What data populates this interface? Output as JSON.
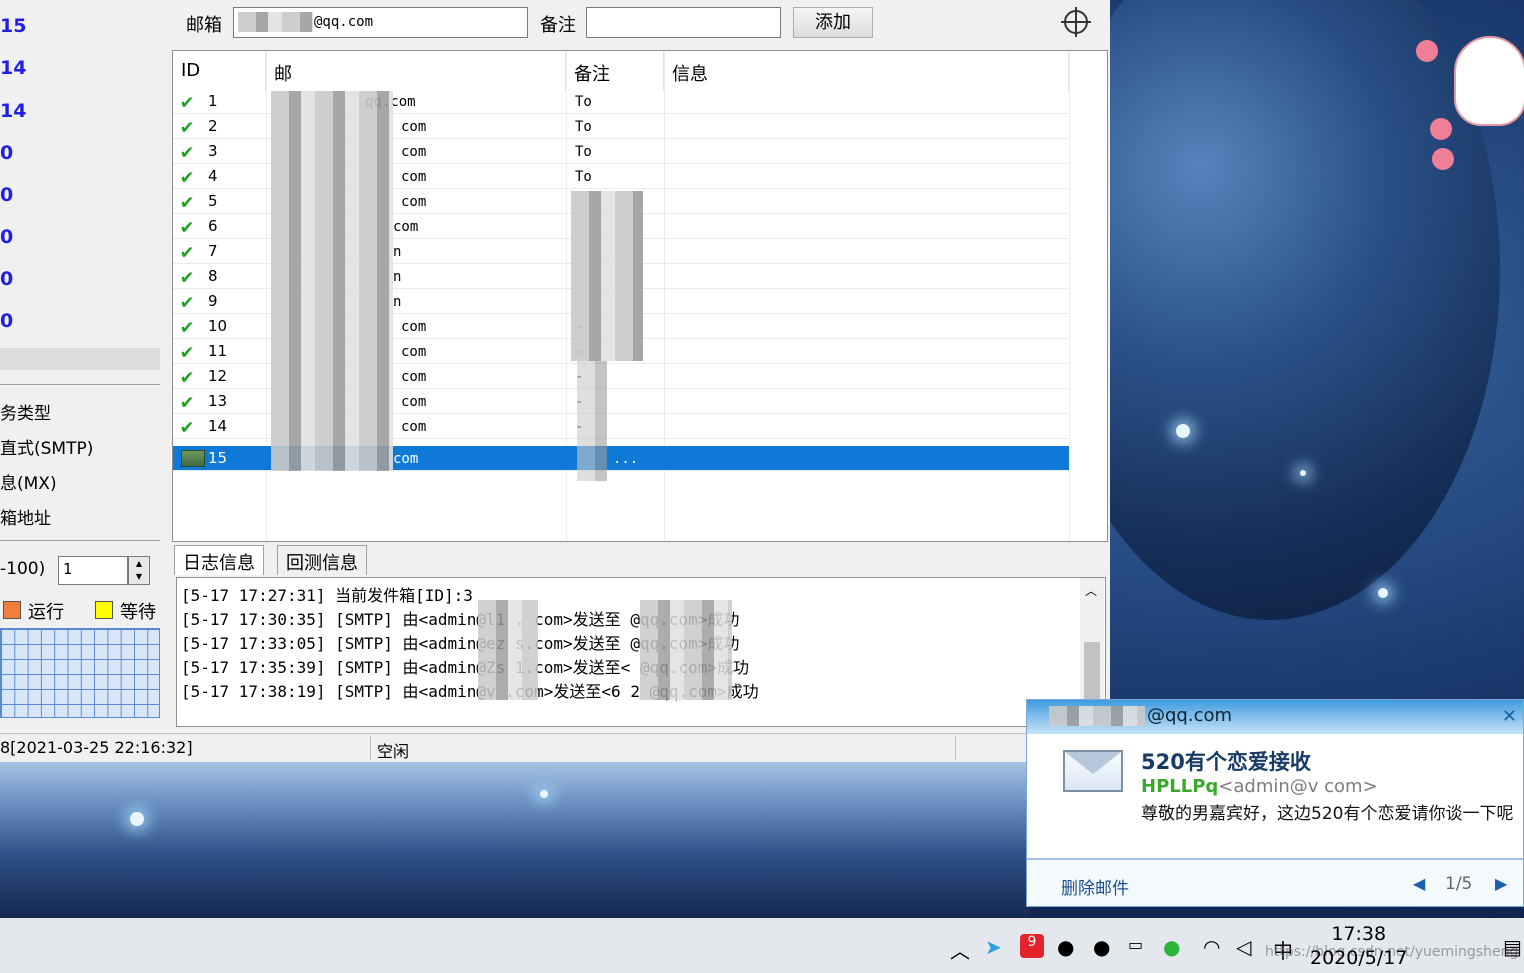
{
  "left_panel": {
    "stats": [
      "15",
      "14",
      "14",
      "0",
      "0",
      "0",
      "0",
      "0"
    ],
    "task_types": [
      "务类型",
      "直式(SMTP)",
      "息(MX)",
      "箱地址"
    ],
    "range_label": "-100)",
    "thread_value": "1",
    "legend": [
      {
        "label": "运行",
        "color": "#f07f3c"
      },
      {
        "label": "等待",
        "color": "#ffff00"
      }
    ]
  },
  "toolbar": {
    "email_label": "邮箱",
    "email_value": "@qq.com",
    "note_label": "备注",
    "note_value": "",
    "add_button": "添加"
  },
  "table": {
    "headers": [
      "ID",
      "邮",
      "备注",
      "信息"
    ],
    "rows": [
      {
        "id": "1",
        "email": "qq.com",
        "note": "To"
      },
      {
        "id": "2",
        "email": "com",
        "note": "To"
      },
      {
        "id": "3",
        "email": "com",
        "note": "To"
      },
      {
        "id": "4",
        "email": "com",
        "note": "To"
      },
      {
        "id": "5",
        "email": "com",
        "note": ""
      },
      {
        "id": "6",
        "email": "com",
        "note": ""
      },
      {
        "id": "7",
        "email": "n",
        "note": ""
      },
      {
        "id": "8",
        "email": "n",
        "note": ""
      },
      {
        "id": "9",
        "email": "n",
        "note": ""
      },
      {
        "id": "10",
        "email": "com",
        "note": "-"
      },
      {
        "id": "11",
        "email": "com",
        "note": "-"
      },
      {
        "id": "12",
        "email": "com",
        "note": "-"
      },
      {
        "id": "13",
        "email": "com",
        "note": "-"
      },
      {
        "id": "14",
        "email": "com",
        "note": "-"
      },
      {
        "id": "15",
        "email": "com",
        "note": "..."
      }
    ],
    "selected_id": "15"
  },
  "tabs": [
    "日志信息",
    "回测信息"
  ],
  "log": [
    "[5-17 17:27:31] 当前发件箱[ID]:3",
    "[5-17 17:30:35] [SMTP] 由<admin@l1 . com>发送至 @qq.com>成功",
    "[5-17 17:33:05] [SMTP] 由<admin@ez s.com>发送至 @qq.com>成功",
    "[5-17 17:35:39] [SMTP] 由<admin@Zs 1.com>发送至< @qq.com>成功",
    "[5-17 17:38:19] [SMTP] 由<admin@v .com>发送至<6 2 @qq.com>成功"
  ],
  "status": {
    "left": "8[2021-03-25 22:16:32]",
    "middle": "空闲"
  },
  "notification": {
    "account": "@qq.com",
    "subject": "520有个恋爱接收",
    "sender_name": "HPLLPq",
    "sender_addr": "<admin@v com>",
    "body": "尊敬的男嘉宾好，这边520有个恋爱请你谈一下呢",
    "delete_label": "删除邮件",
    "page": "1/5"
  },
  "taskbar": {
    "ime": "中",
    "time": "17:38",
    "date": "2020/5/17",
    "watermark": "https://blog.csdn.net/yuemingsheng"
  }
}
